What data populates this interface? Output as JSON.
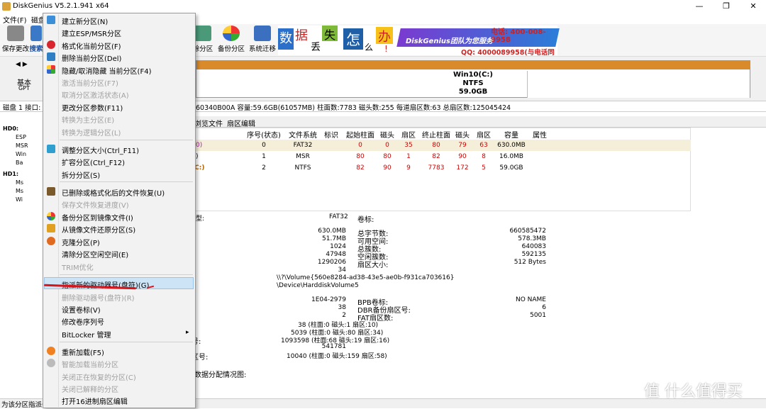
{
  "window": {
    "title": "DiskGenius V5.2.1.941 x64",
    "minimize": "—",
    "maximize": "❐",
    "close": "✕"
  },
  "menubar": {
    "items": [
      "文件(F)",
      "磁盘"
    ]
  },
  "toolbar": {
    "save": "保存更改",
    "search": "搜索",
    "delete": "除分区",
    "backup": "备份分区",
    "migrate": "系统迁移"
  },
  "banner": {
    "tiles": [
      "数",
      "据",
      "丢",
      "失",
      "怎",
      "么",
      "办",
      "!"
    ],
    "brand": "DiskGenius团队为您服务",
    "phone": "电话: 400-008-9958",
    "qq": "QQ: 4000089958(与电话同号)"
  },
  "diskpanel": {
    "mode_label": "基本",
    "mode_sub": "GPT",
    "nav_arrows": "◀ ▶"
  },
  "partition_bar": {
    "name": "Win10(C:)",
    "fs": "NTFS",
    "size": "59.0GB"
  },
  "infobar": {
    "left": "磁盘 1 接口:",
    "right": "60340B00A   容量:59.6GB(61057MB)   柱面数:7783   磁头数:255   每道扇区数:63   总扇区数:125045424"
  },
  "tree": {
    "items": [
      "HD0:",
      "ESP",
      "MSR",
      "Win",
      "Ba",
      "HD1:",
      "Ms",
      "Ms",
      "Wi"
    ]
  },
  "tabs": {
    "browse": "浏览文件",
    "sector": "扇区编辑"
  },
  "table": {
    "headers": [
      "序号(状态)",
      "文件系统",
      "标识",
      "起始柱面",
      "磁头",
      "扇区",
      "终止柱面",
      "磁头",
      "扇区",
      "容量",
      "属性"
    ],
    "rows": [
      {
        "name": "0)",
        "idx": "0",
        "fs": "FAT32",
        "id": "",
        "sc": "0",
        "sh": "0",
        "ss": "35",
        "ec": "80",
        "eh": "79",
        "es": "63",
        "cap": "630.0MB",
        "attr": ""
      },
      {
        "name": ")",
        "idx": "1",
        "fs": "MSR",
        "id": "",
        "sc": "80",
        "sh": "80",
        "ss": "1",
        "ec": "82",
        "eh": "90",
        "es": "8",
        "cap": "16.0MB",
        "attr": ""
      },
      {
        "name": "(C:)",
        "idx": "2",
        "fs": "NTFS",
        "id": "",
        "sc": "82",
        "sh": "90",
        "ss": "9",
        "ec": "7783",
        "eh": "172",
        "es": "5",
        "cap": "59.0GB",
        "attr": ""
      }
    ]
  },
  "details": {
    "type_label": "型:",
    "type_value": "FAT32",
    "vol_label": "卷标:",
    "values_a": [
      "630.0MB",
      "51.7MB",
      "1024",
      "47948",
      "1290206",
      "34"
    ],
    "labels_b": [
      "总字节数:",
      "可用空间:",
      "总簇数:",
      "空闲簇数:",
      "扇区大小:"
    ],
    "values_b": [
      "660585472",
      "578.3MB",
      "640083",
      "592135",
      "512 Bytes"
    ],
    "guid": "\\\\?\\Volume{560e8284-ad38-43e5-ae0b-f931ca703616}",
    "device": "\\Device\\HarddiskVolume5",
    "values_c": [
      "1E04-2979",
      "38",
      "2",
      "38 (柱面:0 磁头:1 扇区:10)",
      "5039 (柱面:0 磁头:80 扇区:34)",
      "1093598 (柱面:68 磁头:19 扇区:16)",
      "541781",
      "10040 (柱面:0 磁头:159 扇区:58)"
    ],
    "labels_c": [
      "BPB卷标:",
      "DBR备份扇区号:",
      "FAT扇区数:"
    ],
    "values_d": [
      "NO NAME",
      "6",
      "5001"
    ],
    "side_labels": [
      "号:",
      "区号:"
    ],
    "map_label": "数据分配情况图:"
  },
  "context_menu": {
    "items": [
      {
        "label": "建立新分区(N)",
        "disabled": false
      },
      {
        "label": "建立ESP/MSR分区",
        "disabled": false
      },
      {
        "label": "格式化当前分区(F)",
        "disabled": false
      },
      {
        "label": "删除当前分区(Del)",
        "disabled": false
      },
      {
        "label": "隐藏/取消隐藏 当前分区(F4)",
        "disabled": false
      },
      {
        "label": "激活当前分区(F7)",
        "disabled": true
      },
      {
        "label": "取消分区激活状态(A)",
        "disabled": true
      },
      {
        "label": "更改分区参数(F11)",
        "disabled": false
      },
      {
        "label": "转换为主分区(E)",
        "disabled": true
      },
      {
        "label": "转换为逻辑分区(L)",
        "disabled": true
      },
      {
        "label": "调整分区大小(Ctrl_F11)",
        "disabled": false
      },
      {
        "label": "扩容分区(Ctrl_F12)",
        "disabled": false
      },
      {
        "label": "拆分分区(S)",
        "disabled": false
      },
      {
        "label": "已删除或格式化后的文件恢复(U)",
        "disabled": false
      },
      {
        "label": "保存文件恢复进度(V)",
        "disabled": true
      },
      {
        "label": "备份分区到镜像文件(I)",
        "disabled": false
      },
      {
        "label": "从镜像文件还原分区(S)",
        "disabled": false
      },
      {
        "label": "克隆分区(P)",
        "disabled": false
      },
      {
        "label": "清除分区空闲空间(E)",
        "disabled": false
      },
      {
        "label": "TRIM优化",
        "disabled": true
      },
      {
        "label": "指派新的驱动器号(盘符)(G)",
        "disabled": false
      },
      {
        "label": "删除驱动器号(盘符)(R)",
        "disabled": true
      },
      {
        "label": "设置卷标(V)",
        "disabled": false
      },
      {
        "label": "修改卷序列号",
        "disabled": false
      },
      {
        "label": "BitLocker 管理",
        "disabled": false
      },
      {
        "label": "重新加载(F5)",
        "disabled": false
      },
      {
        "label": "智能加载当前分区",
        "disabled": true
      },
      {
        "label": "关闭正在恢复的分区(C)",
        "disabled": true
      },
      {
        "label": "关闭已解释的分区",
        "disabled": true
      },
      {
        "label": "打开16进制扇区编辑",
        "disabled": false
      }
    ],
    "submenu_arrow": "▸"
  },
  "statusbar": {
    "text": "为该分区指派一"
  },
  "watermark": {
    "text": "值 什么值得买"
  }
}
